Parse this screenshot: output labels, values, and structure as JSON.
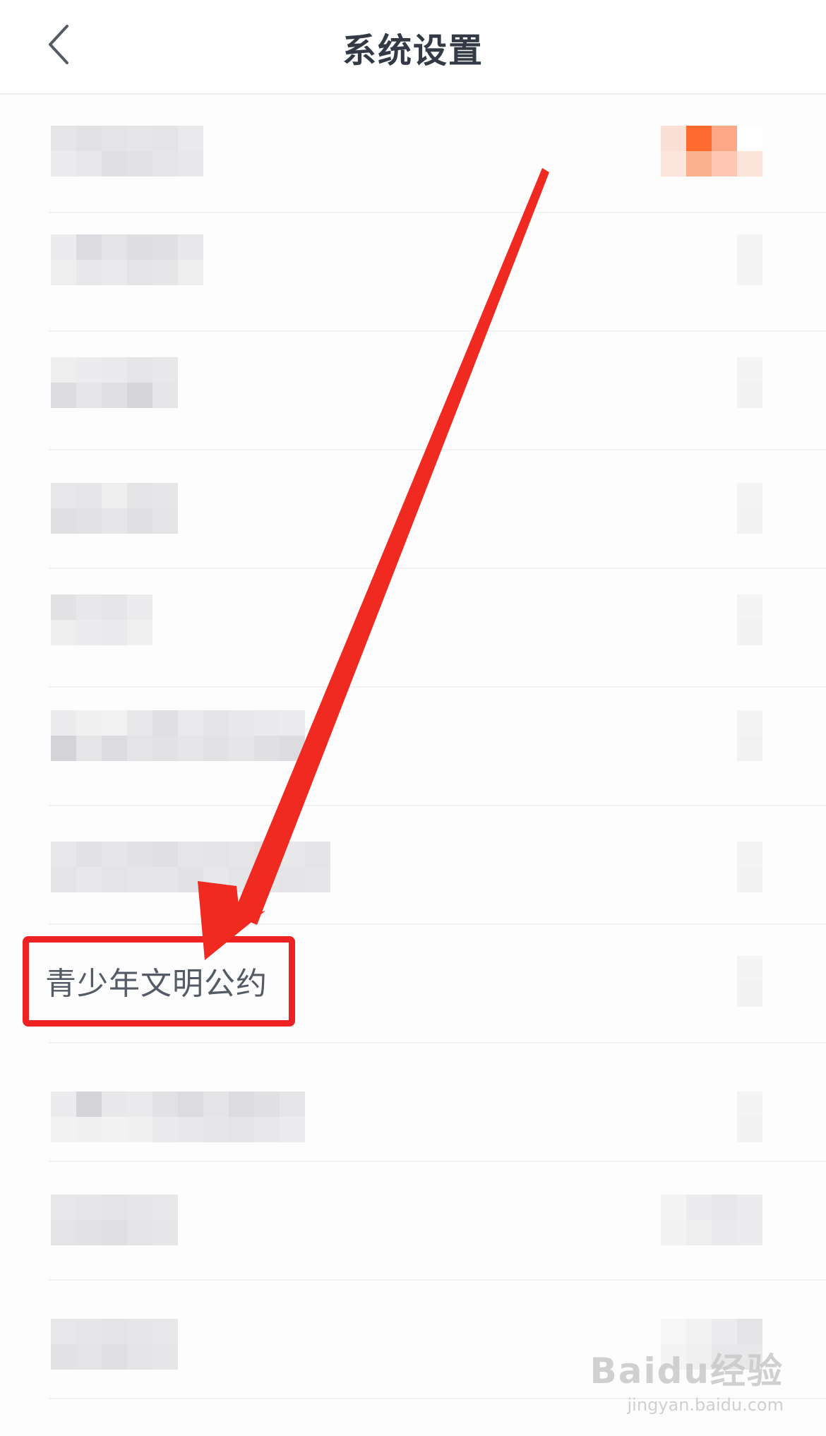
{
  "header": {
    "title": "系统设置",
    "back_icon": "chevron-left-icon"
  },
  "settings": {
    "highlighted_item": "青少年文明公约"
  },
  "watermark": {
    "main": "Baidu经验",
    "sub": "jingyan.baidu.com"
  },
  "colors": {
    "annotation": "#ee2222",
    "title": "#333a45",
    "label": "#555b66",
    "accent_orange": "#ff6a2e"
  }
}
